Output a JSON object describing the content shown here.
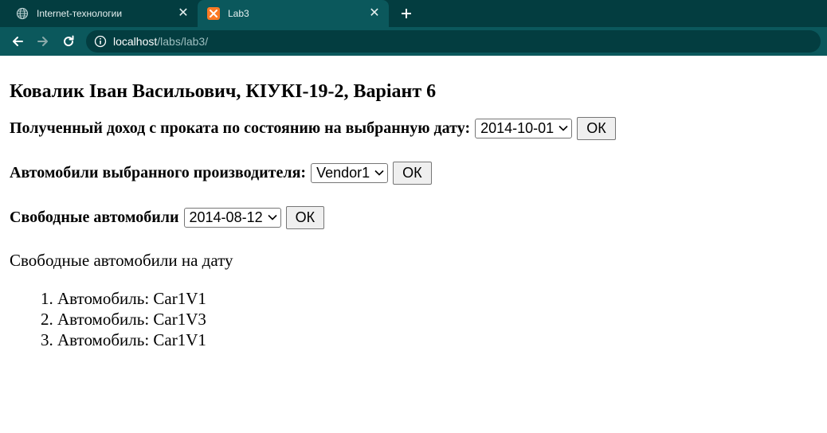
{
  "browser": {
    "tabs": [
      {
        "title": "Internet-технологии",
        "favicon": "globe-icon",
        "active": false
      },
      {
        "title": "Lab3",
        "favicon": "xampp-icon",
        "active": true
      }
    ],
    "new_tab_icon": "plus-icon",
    "url_host": "localhost",
    "url_path": "/labs/lab3/",
    "theme_color": "#0b585c",
    "tabstrip_color": "#033d40"
  },
  "page": {
    "heading": "Ковалик Іван Васильович, КІУКІ-19-2, Варіант 6",
    "forms": {
      "income": {
        "label": "Полученный доход с проката по состоянию на выбранную дату:",
        "selected": "2014-10-01",
        "button": "ОК"
      },
      "vendor": {
        "label": "Автомобили выбранного производителя:",
        "selected": "Vendor1",
        "button": "ОК"
      },
      "free": {
        "label": "Свободные автомобили",
        "selected": "2014-08-12",
        "button": "ОК"
      }
    },
    "result_title": "Свободные автомобили на дату",
    "cars": [
      "Автомобиль: Car1V1",
      "Автомобиль: Car1V3",
      "Автомобиль: Car1V1"
    ]
  }
}
